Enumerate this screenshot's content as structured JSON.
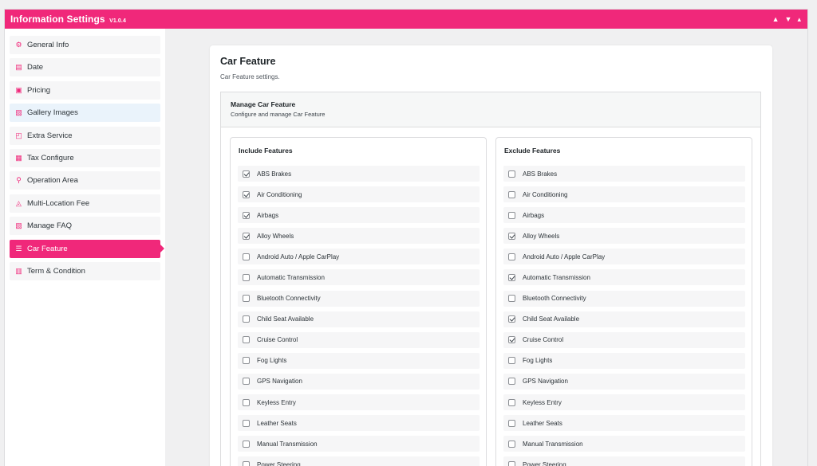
{
  "header": {
    "title": "Information Settings",
    "version": "V1.0.4",
    "controls": [
      "▲",
      "▼",
      "▴"
    ]
  },
  "sidebar": {
    "items": [
      {
        "label": "General Info",
        "icon": "gear-icon",
        "glyph": "⚙"
      },
      {
        "label": "Date",
        "icon": "calendar-icon",
        "glyph": "▤"
      },
      {
        "label": "Pricing",
        "icon": "money-icon",
        "glyph": "▣"
      },
      {
        "label": "Gallery Images",
        "icon": "images-icon",
        "glyph": "▨"
      },
      {
        "label": "Extra Service",
        "icon": "gift-icon",
        "glyph": "◰"
      },
      {
        "label": "Tax Configure",
        "icon": "receipt-icon",
        "glyph": "▦"
      },
      {
        "label": "Operation Area",
        "icon": "route-icon",
        "glyph": "⚲"
      },
      {
        "label": "Multi-Location Fee",
        "icon": "location-fee-icon",
        "glyph": "◬"
      },
      {
        "label": "Manage FAQ",
        "icon": "faq-icon",
        "glyph": "▧"
      },
      {
        "label": "Car Feature",
        "icon": "list-icon",
        "glyph": "☰"
      },
      {
        "label": "Term & Condition",
        "icon": "document-icon",
        "glyph": "▥"
      }
    ],
    "active_index": 9,
    "hover_index": 3
  },
  "card": {
    "title": "Car Feature",
    "description": "Car Feature settings."
  },
  "section": {
    "title": "Manage Car Feature",
    "description": "Configure and manage Car Feature"
  },
  "include": {
    "title": "Include Features",
    "features": [
      {
        "label": "ABS Brakes",
        "checked": true
      },
      {
        "label": "Air Conditioning",
        "checked": true
      },
      {
        "label": "Airbags",
        "checked": true
      },
      {
        "label": "Alloy Wheels",
        "checked": true
      },
      {
        "label": "Android Auto / Apple CarPlay",
        "checked": false
      },
      {
        "label": "Automatic Transmission",
        "checked": false
      },
      {
        "label": "Bluetooth Connectivity",
        "checked": false
      },
      {
        "label": "Child Seat Available",
        "checked": false
      },
      {
        "label": "Cruise Control",
        "checked": false
      },
      {
        "label": "Fog Lights",
        "checked": false
      },
      {
        "label": "GPS Navigation",
        "checked": false
      },
      {
        "label": "Keyless Entry",
        "checked": false
      },
      {
        "label": "Leather Seats",
        "checked": false
      },
      {
        "label": "Manual Transmission",
        "checked": false
      },
      {
        "label": "Power Steering",
        "checked": false
      }
    ]
  },
  "exclude": {
    "title": "Exclude Features",
    "features": [
      {
        "label": "ABS Brakes",
        "checked": false
      },
      {
        "label": "Air Conditioning",
        "checked": false
      },
      {
        "label": "Airbags",
        "checked": false
      },
      {
        "label": "Alloy Wheels",
        "checked": true
      },
      {
        "label": "Android Auto / Apple CarPlay",
        "checked": false
      },
      {
        "label": "Automatic Transmission",
        "checked": true
      },
      {
        "label": "Bluetooth Connectivity",
        "checked": false
      },
      {
        "label": "Child Seat Available",
        "checked": true
      },
      {
        "label": "Cruise Control",
        "checked": true
      },
      {
        "label": "Fog Lights",
        "checked": false
      },
      {
        "label": "GPS Navigation",
        "checked": false
      },
      {
        "label": "Keyless Entry",
        "checked": false
      },
      {
        "label": "Leather Seats",
        "checked": false
      },
      {
        "label": "Manual Transmission",
        "checked": false
      },
      {
        "label": "Power Steering",
        "checked": false
      }
    ]
  },
  "colors": {
    "accent": "#f0287a",
    "hover": "#eaf3fb",
    "item_bg": "#f6f6f7"
  }
}
